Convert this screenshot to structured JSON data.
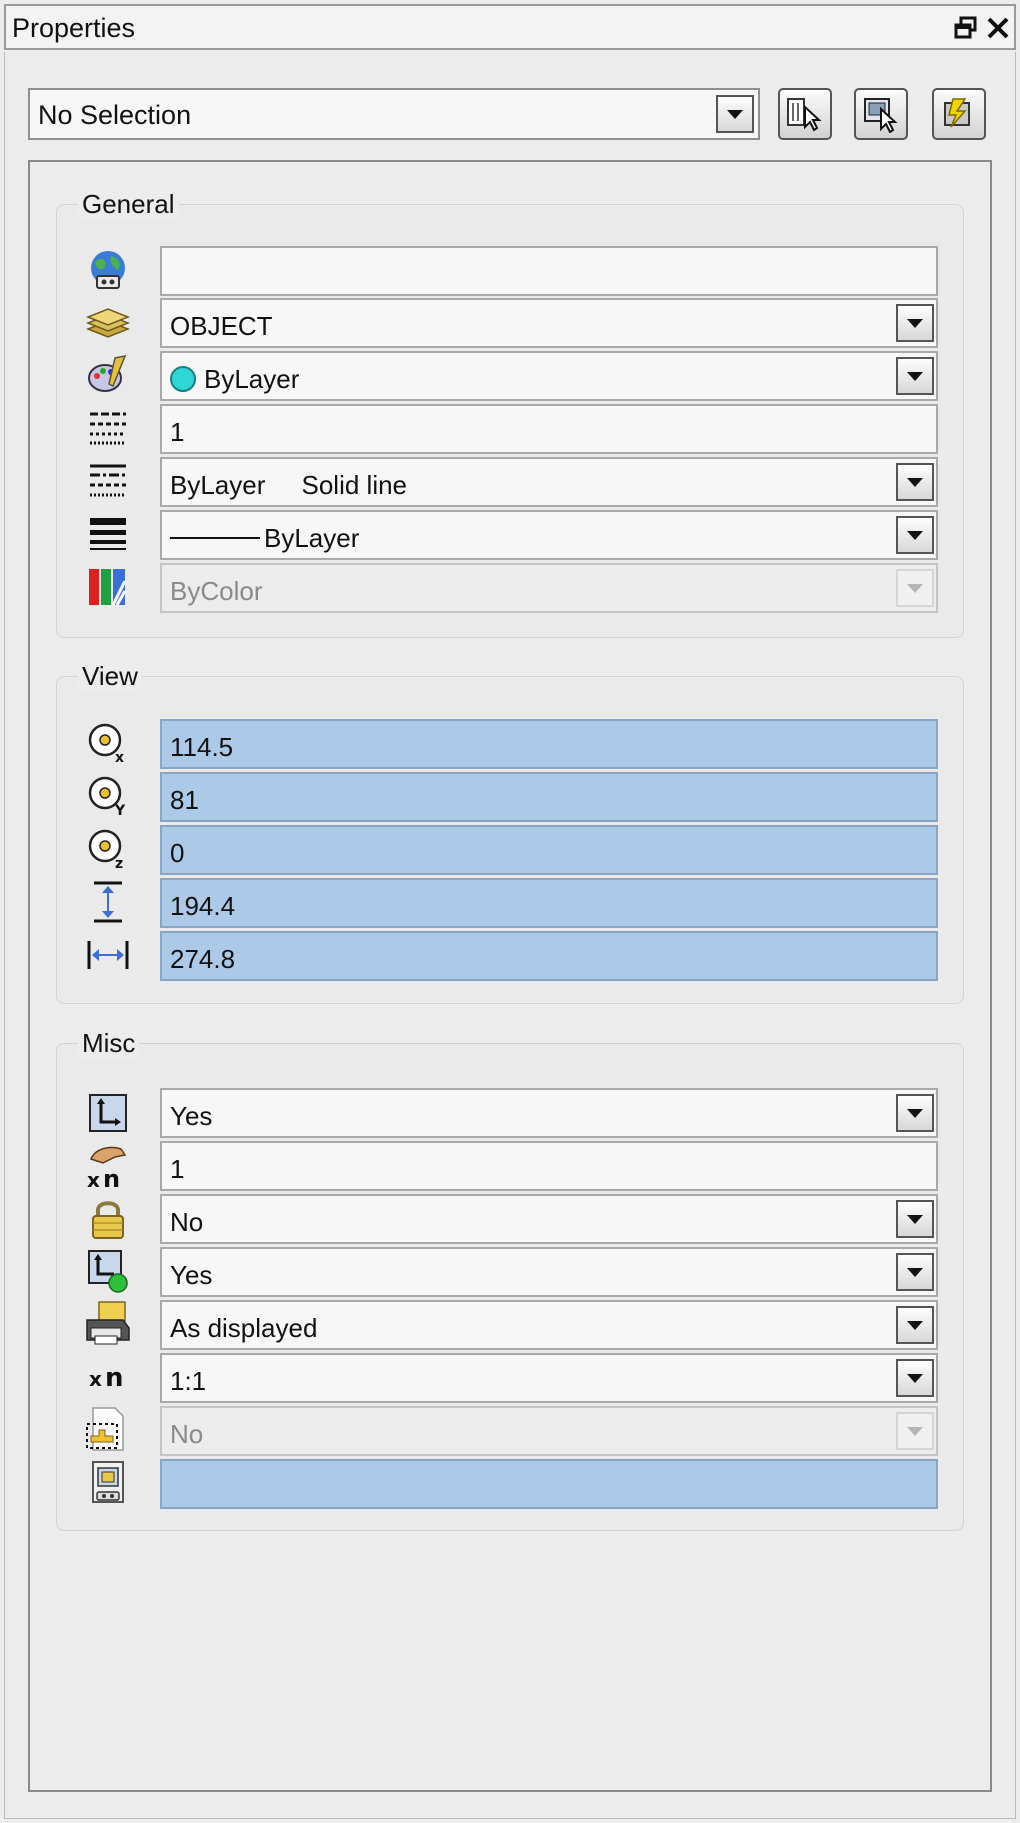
{
  "window": {
    "title": "Properties"
  },
  "toolbar": {
    "selection_value": "No Selection",
    "buttons": [
      "select-objects-icon",
      "quick-select-icon",
      "toggle-pickadd-icon"
    ]
  },
  "general": {
    "title": "General",
    "rows": [
      {
        "icon": "globe-icon",
        "value": "",
        "dropdown": false
      },
      {
        "icon": "layer-icon",
        "value": "OBJECT",
        "dropdown": true
      },
      {
        "icon": "color-icon",
        "value": "ByLayer",
        "color": "#2fd6d6",
        "dropdown": true
      },
      {
        "icon": "linetype-scale-icon",
        "value": "1",
        "dropdown": false
      },
      {
        "icon": "linetype-icon",
        "value": "ByLayer     Solid line",
        "dropdown": true
      },
      {
        "icon": "lineweight-icon",
        "value": "ByLayer",
        "dropdown": true
      },
      {
        "icon": "plotstyle-icon",
        "value": "ByColor",
        "dropdown": true,
        "disabled": true
      }
    ]
  },
  "view": {
    "title": "View",
    "rows": [
      {
        "icon": "center-x-icon",
        "value": "114.5"
      },
      {
        "icon": "center-y-icon",
        "value": "81"
      },
      {
        "icon": "center-z-icon",
        "value": "0"
      },
      {
        "icon": "height-icon",
        "value": "194.4"
      },
      {
        "icon": "width-icon",
        "value": "274.8"
      }
    ]
  },
  "misc": {
    "title": "Misc",
    "rows": [
      {
        "icon": "ucs-icon-on-icon",
        "value": "Yes",
        "dropdown": true
      },
      {
        "icon": "annotation-scale-icon",
        "value": "1",
        "dropdown": false
      },
      {
        "icon": "lock-icon",
        "value": "No",
        "dropdown": true
      },
      {
        "icon": "ucs-per-viewport-icon",
        "value": "Yes",
        "dropdown": true
      },
      {
        "icon": "print-icon",
        "value": "As displayed",
        "dropdown": true
      },
      {
        "icon": "scale-icon",
        "value": "1:1",
        "dropdown": true
      },
      {
        "icon": "sheet-icon",
        "value": "No",
        "dropdown": true,
        "disabled": true
      },
      {
        "icon": "visual-style-icon",
        "value": "",
        "dropdown": false,
        "blue": true
      }
    ]
  }
}
